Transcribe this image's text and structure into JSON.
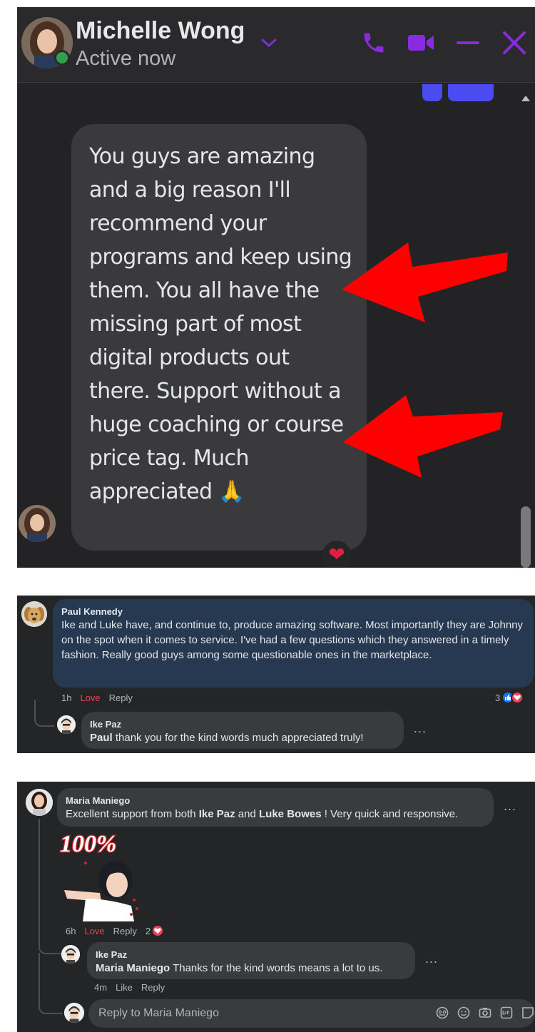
{
  "chat": {
    "contact_name": "Michelle Wong",
    "status": "Active now",
    "message": "You guys are amazing and a big reason I'll recommend your programs and keep using them. You all have the missing part of most digital products out there. Support without a huge coaching or course price tag. Much appreciated 🙏",
    "reaction": "❤",
    "accent_color": "#8a2be2",
    "icons": [
      "chevron-down-icon",
      "phone-icon",
      "video-camera-icon",
      "minimize-icon",
      "close-icon"
    ]
  },
  "comment1": {
    "author": "Paul Kennedy",
    "text": "Ike and Luke have, and continue to, produce amazing software. Most importantly they are Johnny on the spot when it comes to service. I've had a few questions which they answered in a timely fashion. Really good guys among some questionable ones in the marketplace.",
    "time": "1h",
    "reaction_label": "Love",
    "reply_label": "Reply",
    "reaction_count": "3",
    "reply": {
      "author": "Ike Paz",
      "mention": "Paul",
      "text": " thank you for the kind words much appreciated truly!",
      "more": "..."
    }
  },
  "comment2": {
    "author": "Maria Maniego",
    "text_parts": [
      "Excellent support from both ",
      "Ike Paz",
      " and ",
      "Luke Bowes",
      " ! Very quick and responsive."
    ],
    "more": "...",
    "sticker_text": "100%",
    "time": "6h",
    "reaction_label": "Love",
    "reply_label": "Reply",
    "reaction_count": "2",
    "reply": {
      "author": "Ike Paz",
      "mention": "Maria Maniego",
      "text": " Thanks for the kind words means a lot to us.",
      "more": "...",
      "time": "4m",
      "like_label": "Like",
      "reply_label": "Reply"
    },
    "reply_input_placeholder": "Reply to Maria Maniego"
  }
}
